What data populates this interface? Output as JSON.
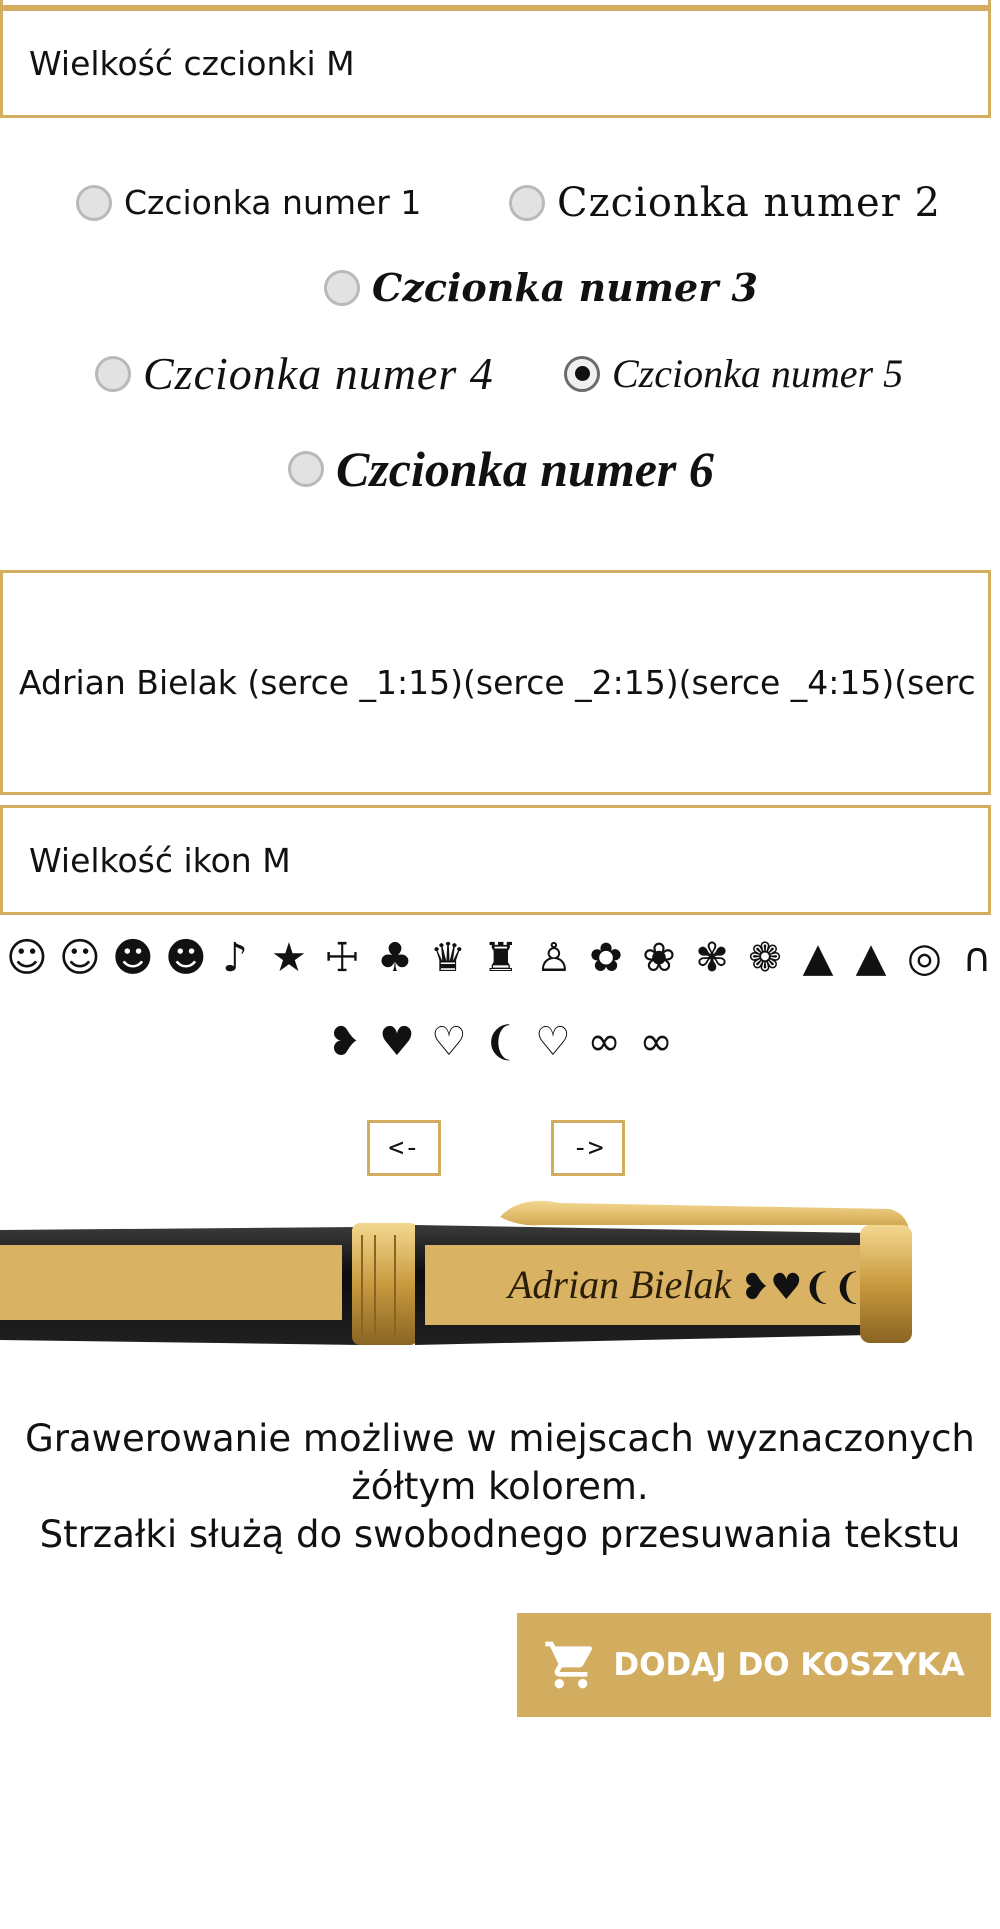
{
  "font_size_select": {
    "value": "Wielkość czcionki M"
  },
  "fonts": [
    {
      "label": "Czcionka numer 1",
      "selected": false
    },
    {
      "label": "Czcionka numer 2",
      "selected": false
    },
    {
      "label": "Czcionka numer 3",
      "selected": false
    },
    {
      "label": "Czcionka numer 4",
      "selected": false
    },
    {
      "label": "Czcionka numer 5",
      "selected": true
    },
    {
      "label": "Czcionka numer 6",
      "selected": false
    }
  ],
  "engraving_text": {
    "value": "Adrian Bielak (serce _1:15)(serce _2:15)(serce _4:15)(serc"
  },
  "icon_size_select": {
    "value": "Wielkość ikon M"
  },
  "icons_row1": [
    "☺",
    "☺",
    "☻",
    "☻",
    "♪",
    "★",
    "☩",
    "♣",
    "♛",
    "♜",
    "♙",
    "✿",
    "❀",
    "✾",
    "❁",
    "▲",
    "▲",
    "◎",
    "∩"
  ],
  "icons_row1_names": [
    "smiley-face-icon",
    "smiley-outline-icon",
    "grin-icon",
    "grin-wide-icon",
    "music-notes-icon",
    "star-icon",
    "ihs-cross-icon",
    "clover-icon",
    "crown-icon",
    "cat-icon",
    "tie-icon",
    "rose-icon",
    "rose-bud-icon",
    "paw-icon",
    "rosette-icon",
    "graduation-cap-icon",
    "graduation-cap-2-icon",
    "wedding-rings-icon",
    "horseshoe-icon"
  ],
  "icons_row2": [
    "❥",
    "♥",
    "♡",
    "❨",
    "♡",
    "∞",
    "∞"
  ],
  "icons_row2_names": [
    "heart-swirl-icon",
    "heart-filled-icon",
    "heart-outline-icon",
    "heart-half-icon",
    "heart-dotted-icon",
    "infinity-icon",
    "infinity-outline-icon"
  ],
  "nav": {
    "prev": "<-",
    "next": "->"
  },
  "preview": {
    "text": "Adrian Bielak",
    "hearts": "❥♥❨❨"
  },
  "note": {
    "line1": "Grawerowanie możliwe w miejscach wyznaczonych",
    "line2": "żółtym kolorem.",
    "line3": "Strzałki służą do swobodnego przesuwania tekstu"
  },
  "cart_button": {
    "label": "DODAJ DO KOSZYKA"
  },
  "colors": {
    "accent": "#d2ad60",
    "pen_black": "#141414",
    "gold": "#d9b263"
  }
}
